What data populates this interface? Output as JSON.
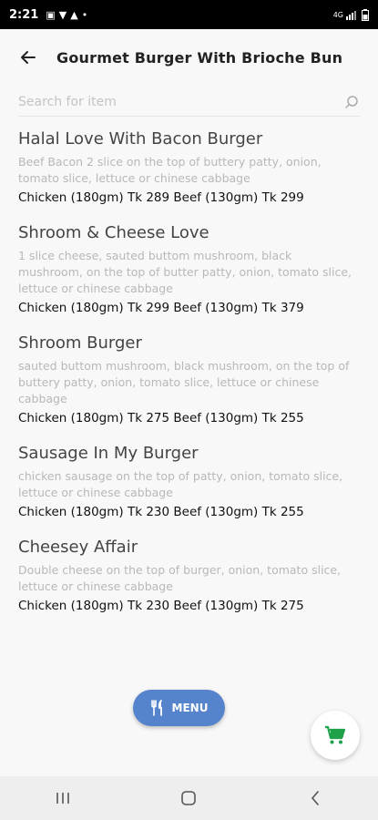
{
  "status_bar": {
    "time": "2:21",
    "network": "4G"
  },
  "header": {
    "title": "Gourmet Burger With Brioche Bun"
  },
  "search": {
    "placeholder": "Search for item"
  },
  "items": [
    {
      "name": "Halal Love With Bacon Burger",
      "description": "Beef Bacon 2 slice on the top of buttery patty, onion, tomato slice, lettuce or chinese cabbage",
      "price": "Chicken (180gm) Tk 289   Beef (130gm) Tk 299"
    },
    {
      "name": "Shroom & Cheese Love",
      "description": "1 slice cheese, sauted buttom mushroom, black mushroom, on the top of butter patty, onion, tomato slice, lettuce or chinese cabbage",
      "price": "Chicken (180gm) Tk 299   Beef (130gm) Tk 379"
    },
    {
      "name": "Shroom Burger",
      "description": "sauted buttom mushroom, black mushroom, on the top of buttery patty, onion, tomato slice, lettuce or chinese cabbage",
      "price": "Chicken (180gm) Tk 275   Beef (130gm) Tk 255"
    },
    {
      "name": "Sausage In My Burger",
      "description": "chicken sausage on the top of patty, onion, tomato slice, lettuce or chinese cabbage",
      "price": "Chicken (180gm) Tk 230   Beef (130gm) Tk 255"
    },
    {
      "name": "Cheesey Affair",
      "description": "Double cheese on the top of burger, onion, tomato slice, lettuce or chinese cabbage",
      "price": "Chicken (180gm) Tk 230   Beef (130gm) Tk 275"
    }
  ],
  "menu_button": {
    "label": "MENU",
    "icon": "fork-knife-icon",
    "color": "#5583cc"
  },
  "cart_button": {
    "icon": "cart-icon",
    "color": "#1fa14a"
  },
  "nav": {
    "icons": [
      "recents-icon",
      "home-icon",
      "back-icon"
    ]
  }
}
